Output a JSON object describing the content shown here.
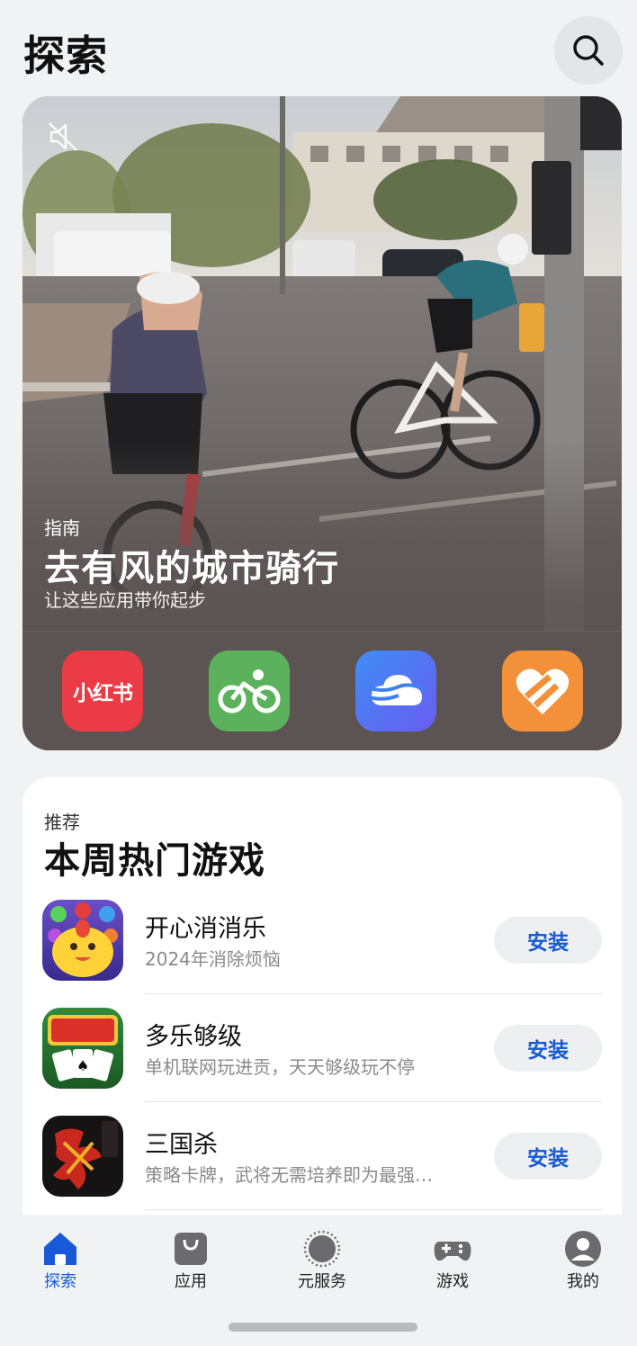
{
  "header": {
    "title": "探索"
  },
  "hero": {
    "tag": "指南",
    "title": "去有风的城市骑行",
    "subtitle": "让这些应用带你起步",
    "apps": [
      {
        "name": "小红书",
        "icon": "xiaohongshu-icon",
        "color": "#ea3b46"
      },
      {
        "name": "cycling",
        "icon": "bicycle-icon",
        "color": "#5cb25c"
      },
      {
        "name": "weather",
        "icon": "wind-cloud-icon",
        "color": "#4a7cf0"
      },
      {
        "name": "fitness",
        "icon": "heart-icon",
        "color": "#f3903a"
      }
    ]
  },
  "recommend": {
    "tag": "推荐",
    "title": "本周热门游戏",
    "games": [
      {
        "name": "开心消消乐",
        "desc": "2024年消除烦恼",
        "install": "安装"
      },
      {
        "name": "多乐够级",
        "desc": "单机联网玩进贡，天天够级玩不停",
        "install": "安装"
      },
      {
        "name": "三国杀",
        "desc": "策略卡牌，武将无需培养即为最强…",
        "install": "安装"
      }
    ]
  },
  "tabs": [
    {
      "label": "探索",
      "icon": "home-icon",
      "active": true
    },
    {
      "label": "应用",
      "icon": "bag-icon",
      "active": false
    },
    {
      "label": "元服务",
      "icon": "ring-icon",
      "active": false
    },
    {
      "label": "游戏",
      "icon": "gamepad-icon",
      "active": false
    },
    {
      "label": "我的",
      "icon": "profile-icon",
      "active": false
    }
  ],
  "colors": {
    "accent": "#1759d6",
    "hero_bg": "#5c5452"
  }
}
